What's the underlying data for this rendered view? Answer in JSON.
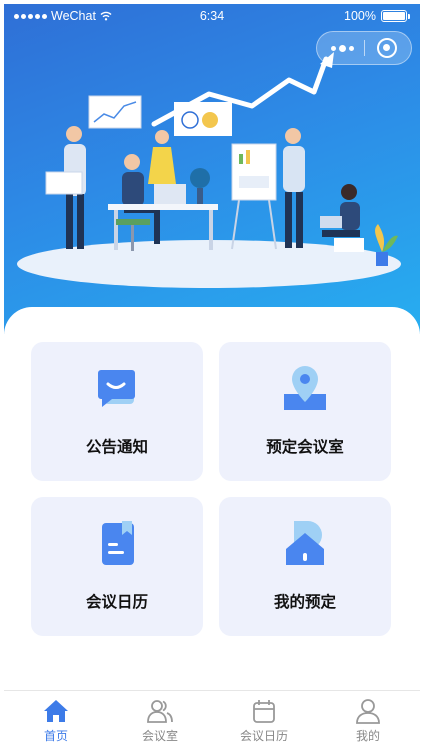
{
  "status_bar": {
    "carrier": "WeChat",
    "time": "6:34",
    "battery": "100%"
  },
  "menu": [
    {
      "label": "公告通知",
      "icon": "message-bubble-icon"
    },
    {
      "label": "预定会议室",
      "icon": "location-pin-icon"
    },
    {
      "label": "会议日历",
      "icon": "document-icon"
    },
    {
      "label": "我的预定",
      "icon": "home-icon"
    }
  ],
  "tabbar": {
    "active_index": 0,
    "items": [
      {
        "label": "首页",
        "icon": "home-icon"
      },
      {
        "label": "会议室",
        "icon": "users-icon"
      },
      {
        "label": "会议日历",
        "icon": "calendar-icon"
      },
      {
        "label": "我的",
        "icon": "user-icon"
      }
    ]
  },
  "colors": {
    "accent": "#3d7be8",
    "hero_top": "#2f6fd6",
    "hero_bottom": "#27aef0",
    "card_bg": "#eef1fc",
    "tab_inactive": "#888888"
  }
}
